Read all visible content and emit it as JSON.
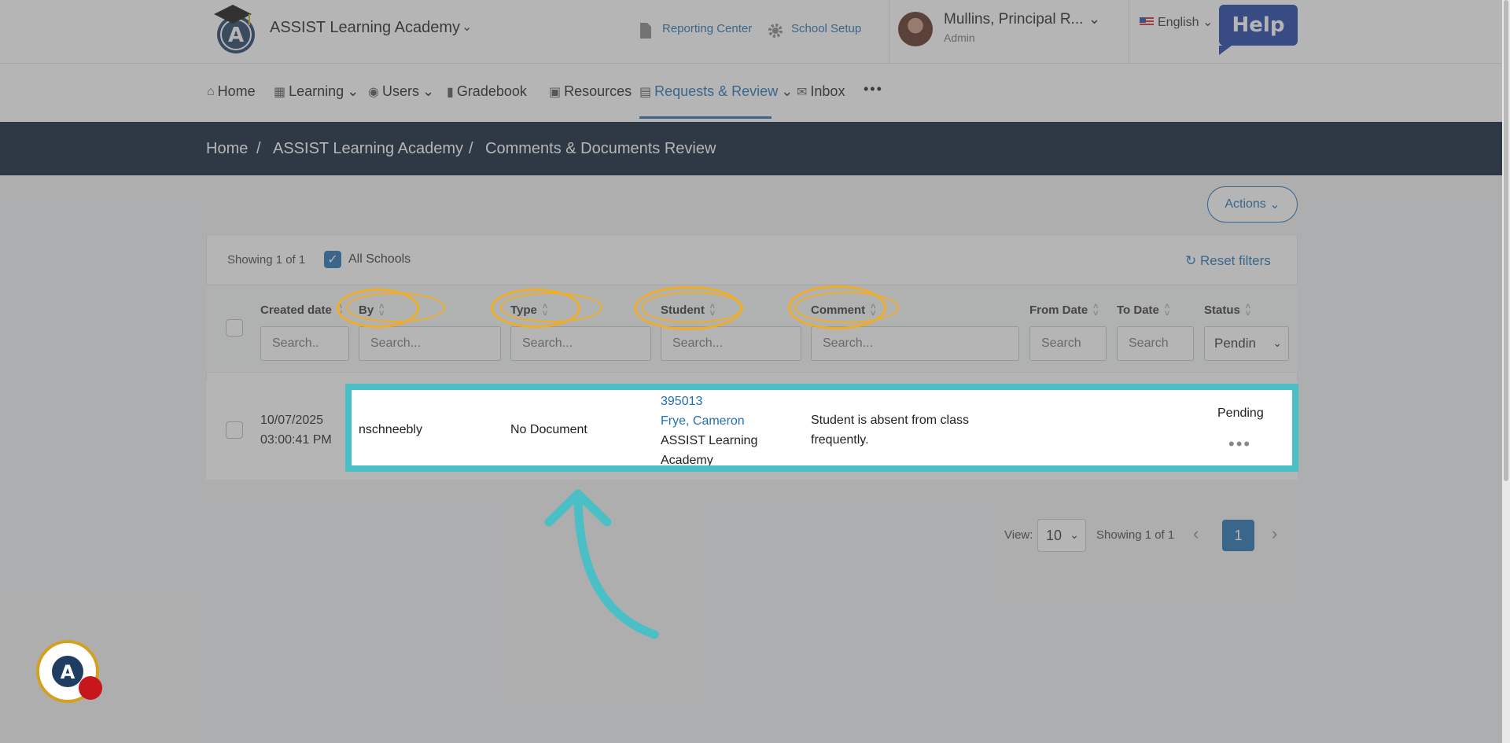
{
  "header": {
    "school_name": "ASSIST Learning Academy",
    "reporting_center": "Reporting Center",
    "school_setup": "School Setup",
    "user_name": "Mullins, Principal R...",
    "user_role": "Admin",
    "language": "English",
    "help": "Help"
  },
  "nav": {
    "home": "Home",
    "learning": "Learning",
    "users": "Users",
    "gradebook": "Gradebook",
    "resources": "Resources",
    "requests_review": "Requests & Review",
    "inbox": "Inbox",
    "more": "•••"
  },
  "breadcrumb": {
    "home": "Home",
    "school": "ASSIST Learning Academy",
    "page": "Comments & Documents Review",
    "sep": "/"
  },
  "toolbar": {
    "actions": "Actions",
    "showing": "Showing 1 of 1",
    "all_schools": "All Schools",
    "reset_filters": "Reset filters"
  },
  "table": {
    "columns": {
      "created_date": "Created date",
      "by": "By",
      "type": "Type",
      "student": "Student",
      "comment": "Comment",
      "from_date": "From Date",
      "to_date": "To Date",
      "status": "Status"
    },
    "placeholders": {
      "created_date": "Search..",
      "by": "Search...",
      "type": "Search...",
      "student": "Search...",
      "comment": "Search...",
      "from_date": "Search",
      "to_date": "Search"
    },
    "status_filter": "Pendin",
    "rows": [
      {
        "date": "10/07/2025",
        "time": "03:00:41 PM",
        "by": "nschneebly",
        "type": "No Document",
        "student_id": "395013",
        "student_name": "Frye, Cameron",
        "school_line1": "ASSIST Learning",
        "school_line2": "Academy",
        "comment_line1": "Student is absent from class",
        "comment_line2": "frequently.",
        "status": "Pending",
        "more": "•••"
      }
    ]
  },
  "pagination": {
    "view_label": "View:",
    "view_value": "10",
    "showing": "Showing 1 of 1",
    "current_page": "1"
  },
  "colors": {
    "accent": "#1f6fb5",
    "navy": "#0b1e33",
    "highlight_teal": "#4bbfc6",
    "highlight_orange": "#f0ac25"
  }
}
